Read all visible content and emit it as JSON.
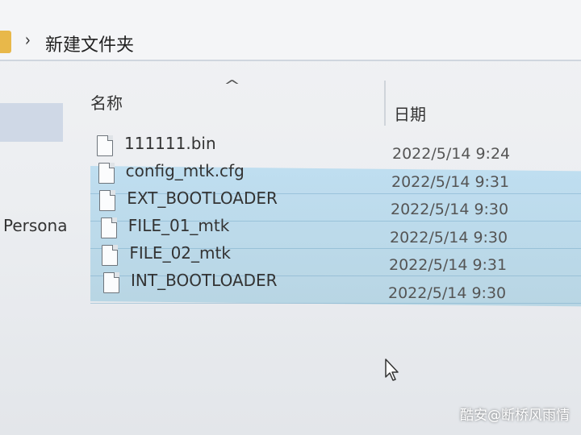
{
  "address": {
    "crumb": "新建文件夹"
  },
  "nav": {
    "label": "Persona"
  },
  "columns": {
    "name": "名称",
    "date": "日期"
  },
  "files": [
    {
      "name": "111111.bin",
      "date": "2022/5/14 9:24",
      "selected": false
    },
    {
      "name": "config_mtk.cfg",
      "date": "2022/5/14 9:31",
      "selected": true
    },
    {
      "name": "EXT_BOOTLOADER",
      "date": "2022/5/14 9:30",
      "selected": true
    },
    {
      "name": "FILE_01_mtk",
      "date": "2022/5/14 9:30",
      "selected": true
    },
    {
      "name": "FILE_02_mtk",
      "date": "2022/5/14 9:31",
      "selected": true
    },
    {
      "name": "INT_BOOTLOADER",
      "date": "2022/5/14 9:30",
      "selected": true
    }
  ],
  "watermark": "酷安@断桥风雨情",
  "colors": {
    "selection": "#b6d8ec",
    "folder": "#e8b84a"
  }
}
